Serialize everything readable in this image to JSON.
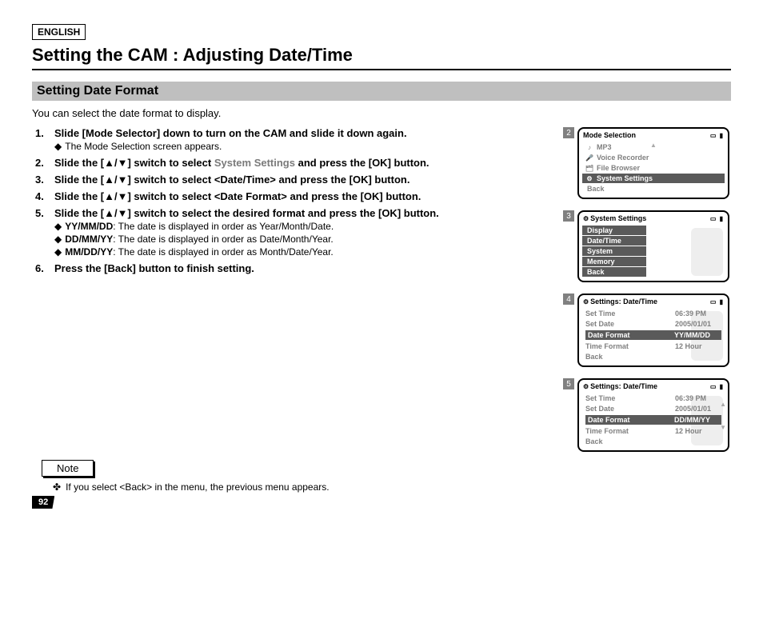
{
  "lang": "ENGLISH",
  "title": "Setting the CAM : Adjusting Date/Time",
  "subtitle": "Setting Date Format",
  "intro": "You can select the date format to display.",
  "steps": [
    {
      "head": "Slide [Mode Selector] down to turn on the CAM and slide it down again.",
      "subs": [
        "The Mode Selection screen appears."
      ]
    },
    {
      "head_parts": {
        "pre": "Slide the [▲/▼] switch to select ",
        "grey": "System Settings",
        "post": " and press the [OK] button."
      },
      "subs": []
    },
    {
      "head": "Slide the [▲/▼] switch to select <Date/Time> and press the [OK] button.",
      "subs": []
    },
    {
      "head": "Slide the [▲/▼] switch to select <Date Format> and press the [OK] button.",
      "subs": []
    },
    {
      "head": "Slide the [▲/▼] switch to select the desired format and press the [OK] button.",
      "subs": [
        {
          "b": "YY/MM/DD",
          "t": ": The date is displayed in order as Year/Month/Date."
        },
        {
          "b": "DD/MM/YY",
          "t": ": The date is displayed in order as Date/Month/Year."
        },
        {
          "b": "MM/DD/YY",
          "t": ": The date is displayed in order as Month/Date/Year."
        }
      ]
    },
    {
      "head": "Press the [Back] button to finish setting.",
      "subs": []
    }
  ],
  "note_label": "Note",
  "note_text": "If you select <Back> in the menu, the previous menu appears.",
  "page_num": "92",
  "screens": {
    "s2": {
      "num": "2",
      "title": "Mode Selection",
      "items": [
        {
          "icon": "♪",
          "label": "MP3"
        },
        {
          "icon": "🎤",
          "label": "Voice Recorder"
        },
        {
          "icon": "🗂",
          "label": "File Browser"
        },
        {
          "icon": "⚙",
          "label": "System Settings",
          "sel": true
        }
      ],
      "back": "Back"
    },
    "s3": {
      "num": "3",
      "title": "System Settings",
      "items": [
        {
          "label": "Display",
          "sel": true,
          "short": true
        },
        {
          "label": "Date/Time",
          "sel": true,
          "short": true
        },
        {
          "label": "System",
          "sel": true,
          "short": true
        },
        {
          "label": "Memory",
          "sel": true,
          "short": true
        },
        {
          "label": "Back",
          "sel": true,
          "short": true
        }
      ]
    },
    "s4": {
      "num": "4",
      "title": "Settings: Date/Time",
      "rows": [
        {
          "k": "Set Time",
          "v": "06:39 PM"
        },
        {
          "k": "Set Date",
          "v": "2005/01/01"
        },
        {
          "k": "Date Format",
          "v": "YY/MM/DD",
          "sel": true
        },
        {
          "k": "Time Format",
          "v": "12 Hour"
        },
        {
          "k": "Back",
          "v": ""
        }
      ]
    },
    "s5": {
      "num": "5",
      "title": "Settings: Date/Time",
      "rows": [
        {
          "k": "Set Time",
          "v": "06:39 PM"
        },
        {
          "k": "Set Date",
          "v": "2005/01/01"
        },
        {
          "k": "Date Format",
          "v": "DD/MM/YY",
          "sel": true
        },
        {
          "k": "Time Format",
          "v": "12 Hour"
        },
        {
          "k": "Back",
          "v": ""
        }
      ]
    }
  }
}
